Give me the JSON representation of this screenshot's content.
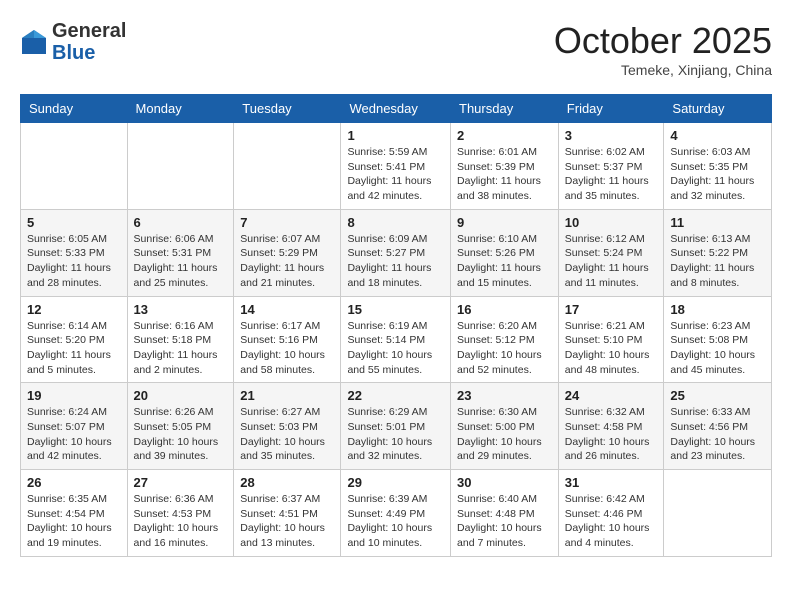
{
  "header": {
    "logo_general": "General",
    "logo_blue": "Blue",
    "month_title": "October 2025",
    "location": "Temeke, Xinjiang, China"
  },
  "weekdays": [
    "Sunday",
    "Monday",
    "Tuesday",
    "Wednesday",
    "Thursday",
    "Friday",
    "Saturday"
  ],
  "weeks": [
    [
      {
        "day": "",
        "info": ""
      },
      {
        "day": "",
        "info": ""
      },
      {
        "day": "",
        "info": ""
      },
      {
        "day": "1",
        "info": "Sunrise: 5:59 AM\nSunset: 5:41 PM\nDaylight: 11 hours\nand 42 minutes."
      },
      {
        "day": "2",
        "info": "Sunrise: 6:01 AM\nSunset: 5:39 PM\nDaylight: 11 hours\nand 38 minutes."
      },
      {
        "day": "3",
        "info": "Sunrise: 6:02 AM\nSunset: 5:37 PM\nDaylight: 11 hours\nand 35 minutes."
      },
      {
        "day": "4",
        "info": "Sunrise: 6:03 AM\nSunset: 5:35 PM\nDaylight: 11 hours\nand 32 minutes."
      }
    ],
    [
      {
        "day": "5",
        "info": "Sunrise: 6:05 AM\nSunset: 5:33 PM\nDaylight: 11 hours\nand 28 minutes."
      },
      {
        "day": "6",
        "info": "Sunrise: 6:06 AM\nSunset: 5:31 PM\nDaylight: 11 hours\nand 25 minutes."
      },
      {
        "day": "7",
        "info": "Sunrise: 6:07 AM\nSunset: 5:29 PM\nDaylight: 11 hours\nand 21 minutes."
      },
      {
        "day": "8",
        "info": "Sunrise: 6:09 AM\nSunset: 5:27 PM\nDaylight: 11 hours\nand 18 minutes."
      },
      {
        "day": "9",
        "info": "Sunrise: 6:10 AM\nSunset: 5:26 PM\nDaylight: 11 hours\nand 15 minutes."
      },
      {
        "day": "10",
        "info": "Sunrise: 6:12 AM\nSunset: 5:24 PM\nDaylight: 11 hours\nand 11 minutes."
      },
      {
        "day": "11",
        "info": "Sunrise: 6:13 AM\nSunset: 5:22 PM\nDaylight: 11 hours\nand 8 minutes."
      }
    ],
    [
      {
        "day": "12",
        "info": "Sunrise: 6:14 AM\nSunset: 5:20 PM\nDaylight: 11 hours\nand 5 minutes."
      },
      {
        "day": "13",
        "info": "Sunrise: 6:16 AM\nSunset: 5:18 PM\nDaylight: 11 hours\nand 2 minutes."
      },
      {
        "day": "14",
        "info": "Sunrise: 6:17 AM\nSunset: 5:16 PM\nDaylight: 10 hours\nand 58 minutes."
      },
      {
        "day": "15",
        "info": "Sunrise: 6:19 AM\nSunset: 5:14 PM\nDaylight: 10 hours\nand 55 minutes."
      },
      {
        "day": "16",
        "info": "Sunrise: 6:20 AM\nSunset: 5:12 PM\nDaylight: 10 hours\nand 52 minutes."
      },
      {
        "day": "17",
        "info": "Sunrise: 6:21 AM\nSunset: 5:10 PM\nDaylight: 10 hours\nand 48 minutes."
      },
      {
        "day": "18",
        "info": "Sunrise: 6:23 AM\nSunset: 5:08 PM\nDaylight: 10 hours\nand 45 minutes."
      }
    ],
    [
      {
        "day": "19",
        "info": "Sunrise: 6:24 AM\nSunset: 5:07 PM\nDaylight: 10 hours\nand 42 minutes."
      },
      {
        "day": "20",
        "info": "Sunrise: 6:26 AM\nSunset: 5:05 PM\nDaylight: 10 hours\nand 39 minutes."
      },
      {
        "day": "21",
        "info": "Sunrise: 6:27 AM\nSunset: 5:03 PM\nDaylight: 10 hours\nand 35 minutes."
      },
      {
        "day": "22",
        "info": "Sunrise: 6:29 AM\nSunset: 5:01 PM\nDaylight: 10 hours\nand 32 minutes."
      },
      {
        "day": "23",
        "info": "Sunrise: 6:30 AM\nSunset: 5:00 PM\nDaylight: 10 hours\nand 29 minutes."
      },
      {
        "day": "24",
        "info": "Sunrise: 6:32 AM\nSunset: 4:58 PM\nDaylight: 10 hours\nand 26 minutes."
      },
      {
        "day": "25",
        "info": "Sunrise: 6:33 AM\nSunset: 4:56 PM\nDaylight: 10 hours\nand 23 minutes."
      }
    ],
    [
      {
        "day": "26",
        "info": "Sunrise: 6:35 AM\nSunset: 4:54 PM\nDaylight: 10 hours\nand 19 minutes."
      },
      {
        "day": "27",
        "info": "Sunrise: 6:36 AM\nSunset: 4:53 PM\nDaylight: 10 hours\nand 16 minutes."
      },
      {
        "day": "28",
        "info": "Sunrise: 6:37 AM\nSunset: 4:51 PM\nDaylight: 10 hours\nand 13 minutes."
      },
      {
        "day": "29",
        "info": "Sunrise: 6:39 AM\nSunset: 4:49 PM\nDaylight: 10 hours\nand 10 minutes."
      },
      {
        "day": "30",
        "info": "Sunrise: 6:40 AM\nSunset: 4:48 PM\nDaylight: 10 hours\nand 7 minutes."
      },
      {
        "day": "31",
        "info": "Sunrise: 6:42 AM\nSunset: 4:46 PM\nDaylight: 10 hours\nand 4 minutes."
      },
      {
        "day": "",
        "info": ""
      }
    ]
  ]
}
